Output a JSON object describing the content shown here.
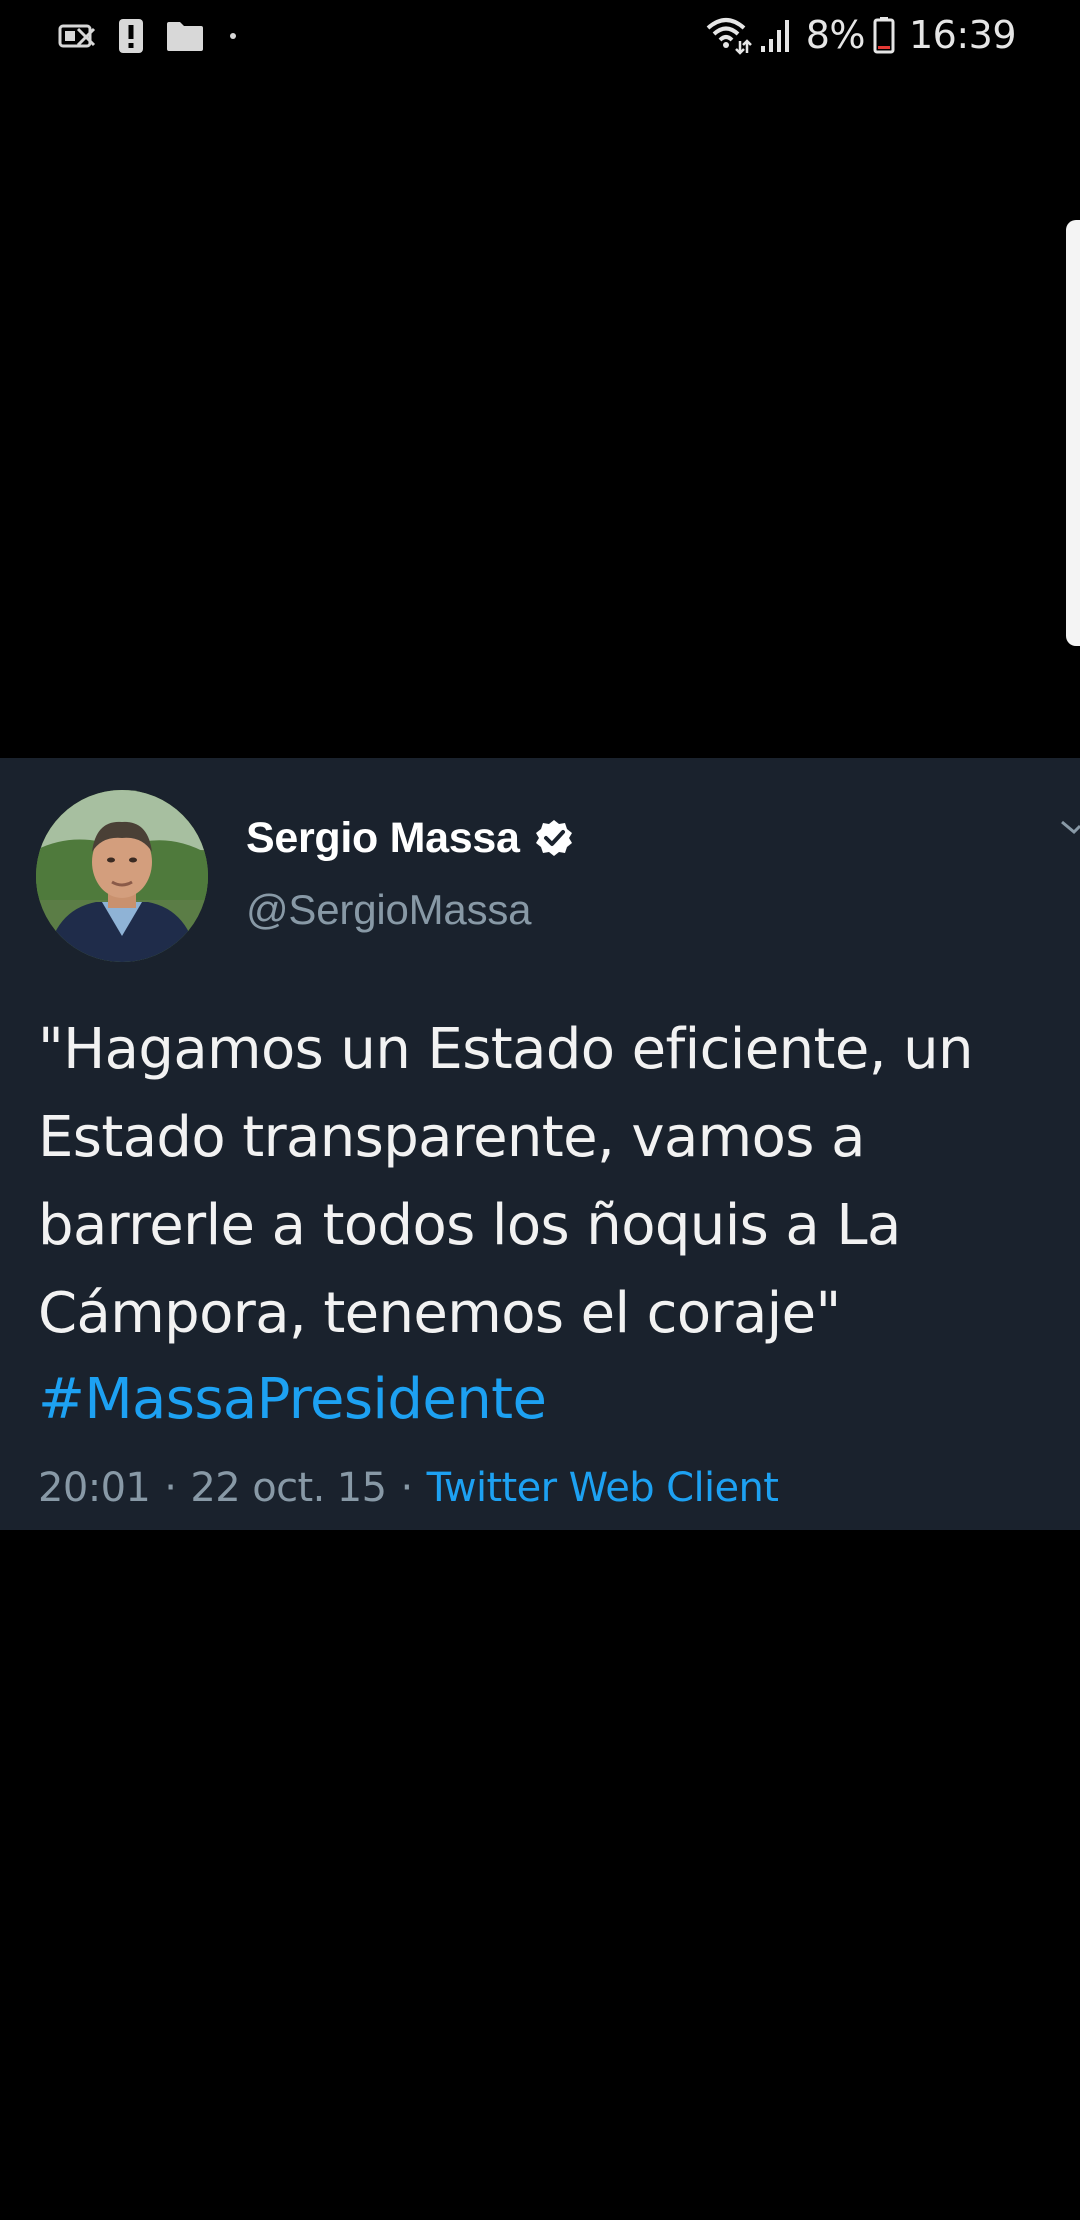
{
  "status_bar": {
    "left_icons": [
      "no-sim-icon",
      "alert-icon",
      "folder-icon",
      "dot-icon"
    ],
    "right_icons": [
      "wifi-icon",
      "signal-icon",
      "battery-icon"
    ],
    "battery_percent": "8%",
    "time": "16:39"
  },
  "tweet": {
    "display_name": "Sergio Massa",
    "verified": true,
    "handle": "@SergioMassa",
    "text": "\"Hagamos un Estado eficiente, un\nEstado transparente, vamos a\nbarrerle a todos los ñoquis a La\nCámpora, tenemos el coraje\"",
    "hashtag": "#MassaPresidente",
    "time": "20:01",
    "separator": "·",
    "date": "22 oct. 15",
    "client": "Twitter Web Client"
  },
  "colors": {
    "background": "#000000",
    "card": "#1a222d",
    "link": "#1da1f2",
    "secondary_text": "#8899a6"
  }
}
